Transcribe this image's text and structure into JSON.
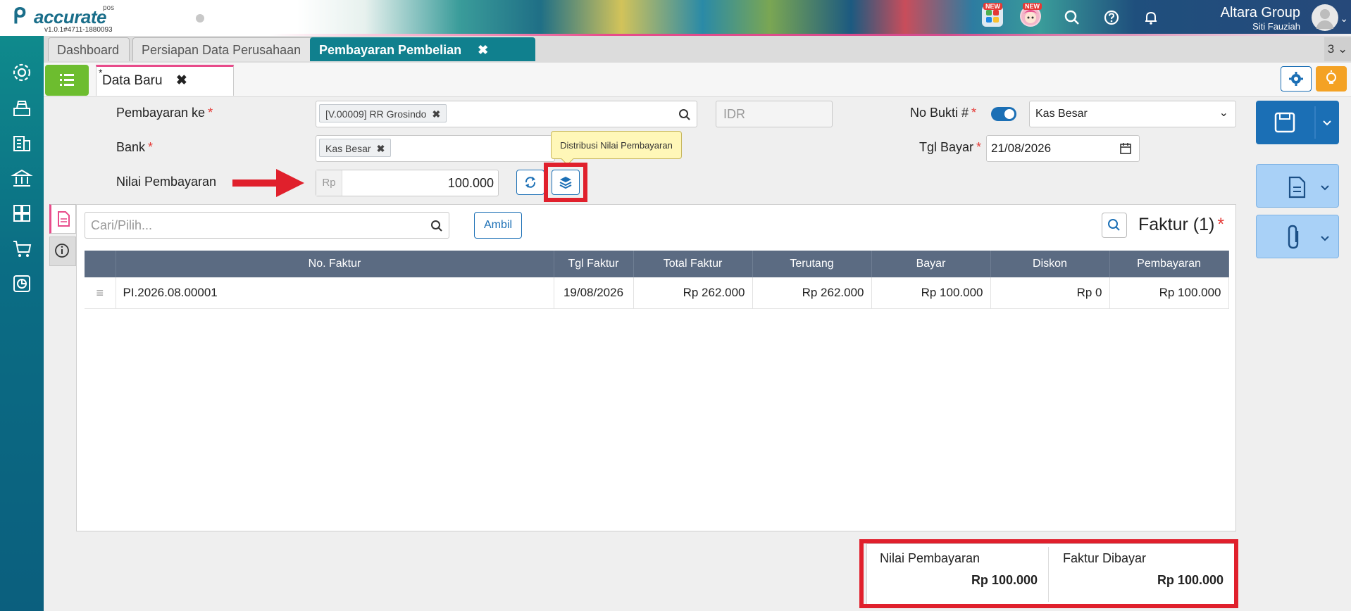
{
  "app": {
    "logo_text": "accurate",
    "logo_sub": "pos",
    "version": "v1.0.1#4711-1880093",
    "new_badge": "NEW",
    "company": "Altara Group",
    "user": "Siti Fauziah"
  },
  "tabs": [
    {
      "label": "Dashboard"
    },
    {
      "label": "Persiapan Data Perusahaan"
    },
    {
      "label": "Pembayaran Pembelian",
      "active": true
    }
  ],
  "tab_count": "3",
  "subtab": {
    "star": "*",
    "label": "Data Baru"
  },
  "form": {
    "pembayaran_ke_label": "Pembayaran ke",
    "pembayaran_ke_value": "[V.00009] RR Grosindo",
    "currency": "IDR",
    "bank_label": "Bank",
    "bank_value": "Kas Besar",
    "nilai_label": "Nilai Pembayaran",
    "nilai_prefix": "Rp",
    "nilai_value": "100.000",
    "no_bukti_label": "No Bukti #",
    "no_bukti_select": "Kas Besar",
    "tgl_bayar_label": "Tgl Bayar",
    "tgl_bayar_value": "21/08/2026",
    "required_mark": "*"
  },
  "tooltip": "Distribusi Nilai Pembayaran",
  "faktur": {
    "search_placeholder": "Cari/Pilih...",
    "ambil_label": "Ambil",
    "title": "Faktur (1)",
    "columns": [
      "",
      "No. Faktur",
      "Tgl Faktur",
      "Total Faktur",
      "Terutang",
      "Bayar",
      "Diskon",
      "Pembayaran"
    ],
    "rows": [
      {
        "no": "PI.2026.08.00001",
        "tgl": "19/08/2026",
        "total": "Rp 262.000",
        "terutang": "Rp 262.000",
        "bayar": "Rp 100.000",
        "diskon": "Rp 0",
        "pembayaran": "Rp 100.000"
      }
    ]
  },
  "summary": {
    "nilai_label": "Nilai Pembayaran",
    "nilai_value": "Rp 100.000",
    "faktur_label": "Faktur Dibayar",
    "faktur_value": "Rp 100.000"
  },
  "colors": {
    "accent_teal": "#10808e",
    "primary_blue": "#1b6fb5",
    "highlight_red": "#e0202c",
    "list_green": "#6dbd2f",
    "bulb_orange": "#f4a224"
  }
}
